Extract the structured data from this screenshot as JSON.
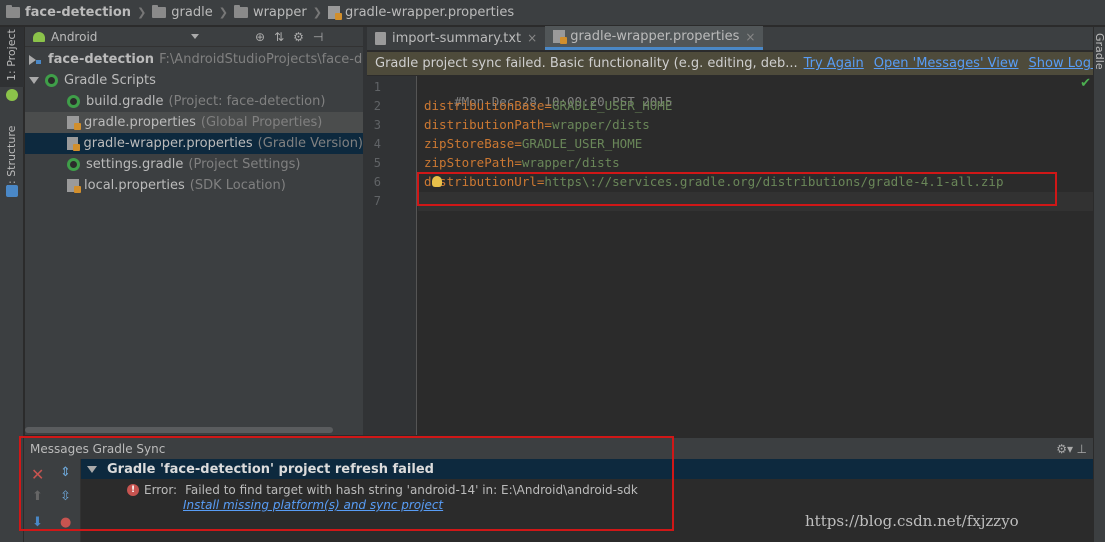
{
  "breadcrumb": [
    {
      "label": "face-detection",
      "icon": "module-folder-icon",
      "bold": true
    },
    {
      "label": "gradle",
      "icon": "folder-icon"
    },
    {
      "label": "wrapper",
      "icon": "folder-icon"
    },
    {
      "label": "gradle-wrapper.properties",
      "icon": "properties-file-icon"
    }
  ],
  "left_strip": {
    "project_tab": "1: Project",
    "structure_tab": "7: Structure"
  },
  "project_panel": {
    "view": "Android",
    "tree": [
      {
        "name": "face-detection",
        "hint": "F:\\AndroidStudioProjects\\face-detection",
        "bold": true
      },
      {
        "name": "Gradle Scripts",
        "hint": ""
      },
      {
        "name": "build.gradle",
        "hint": "(Project: face-detection)"
      },
      {
        "name": "gradle.properties",
        "hint": "(Global Properties)"
      },
      {
        "name": "gradle-wrapper.properties",
        "hint": "(Gradle Version)"
      },
      {
        "name": "settings.gradle",
        "hint": "(Project Settings)"
      },
      {
        "name": "local.properties",
        "hint": "(SDK Location)"
      }
    ]
  },
  "tabs": [
    {
      "label": "import-summary.txt",
      "active": false
    },
    {
      "label": "gradle-wrapper.properties",
      "active": true
    }
  ],
  "banner": {
    "text": "Gradle project sync failed. Basic functionality (e.g. editing, deb...",
    "links": [
      "Try Again",
      "Open 'Messages' View",
      "Show Log in Explorer"
    ]
  },
  "editor": {
    "lines": [
      {
        "n": "1",
        "comment": "#Mon Dec 28 10:00:20 PST 2015"
      },
      {
        "n": "2",
        "key": "distributionBase",
        "value": "GRADLE_USER_HOME"
      },
      {
        "n": "3",
        "key": "distributionPath",
        "value": "wrapper/dists"
      },
      {
        "n": "4",
        "key": "zipStoreBase",
        "value": "GRADLE_USER_HOME"
      },
      {
        "n": "5",
        "key": "zipStorePath",
        "value": "wrapper/dists"
      },
      {
        "n": "6",
        "key": "distributionUrl",
        "value": "https\\://services.gradle.org/distributions/gradle-4.1-all.zip"
      },
      {
        "n": "7"
      }
    ]
  },
  "right_strip": {
    "label": "Gradle"
  },
  "messages": {
    "title": "Messages Gradle Sync",
    "header": "Gradle 'face-detection' project refresh failed",
    "error_label": "Error:",
    "error_text": "Failed to find target with hash string 'android-14' in: E:\\Android\\android-sdk",
    "link": "Install missing platform(s) and sync project"
  },
  "watermark": "https://blog.csdn.net/fxjzzyo",
  "colors": {
    "accent": "#4a88c7",
    "error": "#c75450",
    "annotation": "#d01717",
    "link": "#589df6"
  }
}
